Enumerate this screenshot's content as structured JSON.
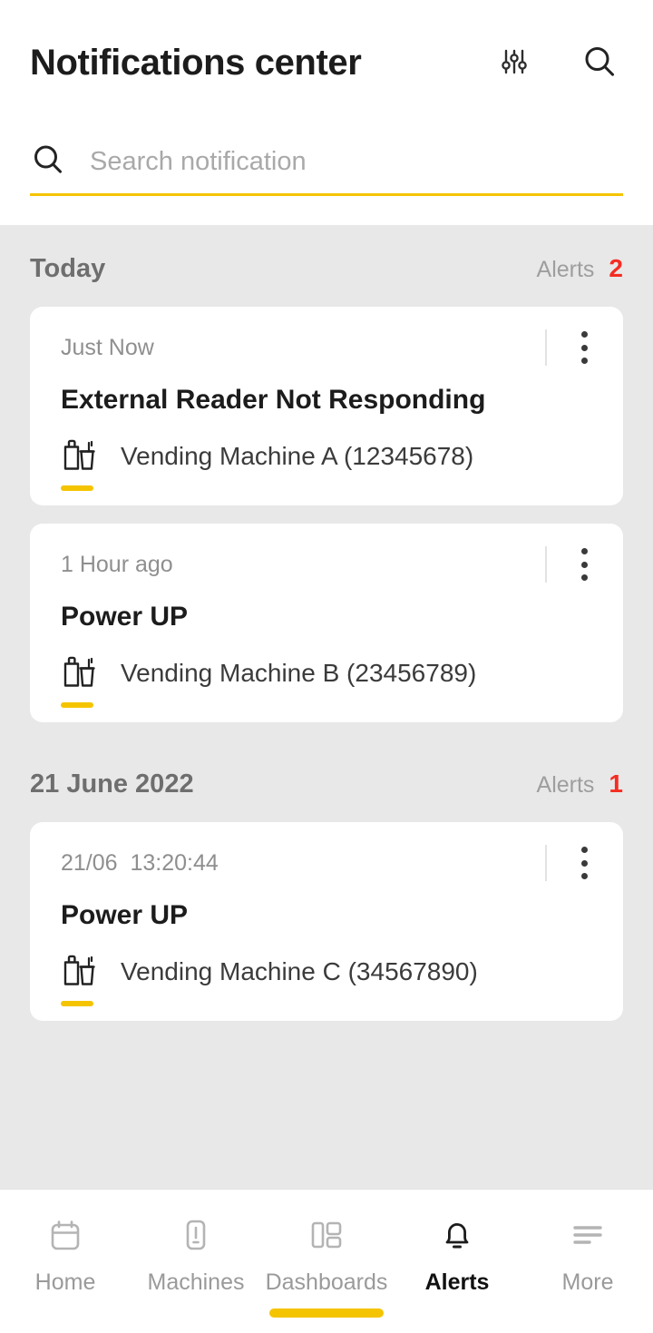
{
  "header": {
    "title": "Notifications center",
    "filter_icon": "sliders-filter-icon",
    "search_icon": "search-icon"
  },
  "search": {
    "placeholder": "Search notification",
    "value": "",
    "icon": "search-icon"
  },
  "sections": [
    {
      "title": "Today",
      "alerts_label": "Alerts",
      "alerts_count": "2",
      "notifications": [
        {
          "time": "Just Now",
          "title": "External Reader Not Responding",
          "machine": "Vending Machine A (12345678)",
          "machine_icon": "vending-machine-icon",
          "menu_icon": "kebab-menu-icon"
        },
        {
          "time": "1 Hour ago",
          "title": "Power UP",
          "machine": "Vending Machine B (23456789)",
          "machine_icon": "vending-machine-icon",
          "menu_icon": "kebab-menu-icon"
        }
      ]
    },
    {
      "title": "21 June 2022",
      "alerts_label": "Alerts",
      "alerts_count": "1",
      "notifications": [
        {
          "time": "21/06  13:20:44",
          "title": "Power UP",
          "machine": "Vending Machine C (34567890)",
          "machine_icon": "vending-machine-icon",
          "menu_icon": "kebab-menu-icon"
        }
      ]
    }
  ],
  "bottom_nav": {
    "items": [
      {
        "label": "Home",
        "icon": "calendar-icon",
        "active": false
      },
      {
        "label": "Machines",
        "icon": "device-alert-icon",
        "active": false
      },
      {
        "label": "Dashboards",
        "icon": "dashboard-grid-icon",
        "active": false
      },
      {
        "label": "Alerts",
        "icon": "bell-icon",
        "active": true
      },
      {
        "label": "More",
        "icon": "menu-lines-icon",
        "active": false
      }
    ]
  },
  "colors": {
    "accent_yellow": "#f5c400",
    "alert_red": "#f52c22",
    "page_background": "#e8e8e8",
    "card_background": "#ffffff",
    "text_primary": "#1c1c1c",
    "text_muted": "#8f8f8f"
  }
}
